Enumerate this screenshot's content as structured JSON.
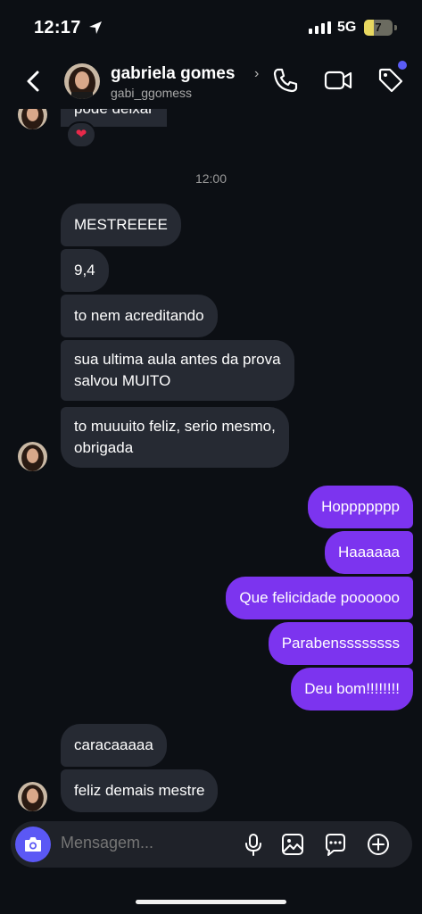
{
  "status_bar": {
    "time": "12:17",
    "network": "5G",
    "battery": "7",
    "battery_level": 0.07
  },
  "header": {
    "name": "gabriela gomes",
    "handle": "gabi_ggomess"
  },
  "thread": {
    "partial_message": "pode deixar",
    "reaction": "❤",
    "timestamp": "12:00",
    "messages": [
      {
        "from": "them",
        "text": "MESTREEEE"
      },
      {
        "from": "them",
        "text": "9,4"
      },
      {
        "from": "them",
        "text": "to nem acreditando"
      },
      {
        "from": "them",
        "lines": [
          "sua ultima aula antes da prova",
          "salvou MUITO"
        ]
      },
      {
        "from": "them",
        "lines": [
          "to muuuito feliz, serio mesmo,",
          "obrigada"
        ]
      },
      {
        "from": "me",
        "text": "Hoppppppp"
      },
      {
        "from": "me",
        "text": "Haaaaaa"
      },
      {
        "from": "me",
        "text": "Que felicidade poooooo"
      },
      {
        "from": "me",
        "text": "Parabenssssssss"
      },
      {
        "from": "me",
        "text": "Deu bom!!!!!!!!"
      },
      {
        "from": "them",
        "text": "caracaaaaa"
      },
      {
        "from": "them",
        "text": "feliz demais mestre"
      }
    ]
  },
  "composer": {
    "placeholder": "Mensagem..."
  },
  "colors": {
    "background": "#0c0f14",
    "incoming_bubble": "#262a33",
    "outgoing_bubble": "#7c34ef",
    "accent": "#5b58f5"
  }
}
